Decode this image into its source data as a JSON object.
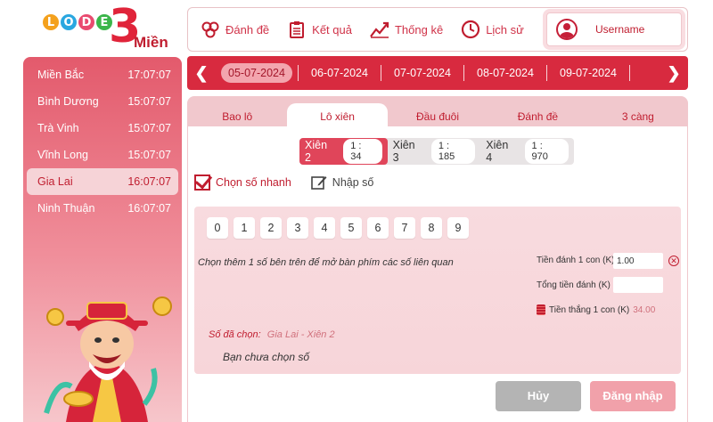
{
  "logo": {
    "letters": [
      "L",
      "O",
      "D",
      "E"
    ],
    "ball_colors": [
      "#f4a11d",
      "#2aa7e0",
      "#e94a6f",
      "#3bb54a"
    ],
    "big_number": "3",
    "word": "Miền"
  },
  "nav": {
    "items": [
      {
        "label": "Đánh đề",
        "icon": "dice-icon"
      },
      {
        "label": "Kết quả",
        "icon": "clipboard-icon"
      },
      {
        "label": "Thống kê",
        "icon": "chart-icon"
      },
      {
        "label": "Lịch sử",
        "icon": "clock-icon"
      }
    ],
    "username": "Username"
  },
  "sidebar": {
    "items": [
      {
        "name": "Miền Bắc",
        "time": "17:07:07"
      },
      {
        "name": "Bình Dương",
        "time": "15:07:07"
      },
      {
        "name": "Trà Vinh",
        "time": "15:07:07"
      },
      {
        "name": "Vĩnh Long",
        "time": "15:07:07"
      },
      {
        "name": "Gia Lai",
        "time": "16:07:07"
      },
      {
        "name": "Ninh Thuận",
        "time": "16:07:07"
      }
    ],
    "active_index": 4
  },
  "dates": {
    "items": [
      "05-07-2024",
      "06-07-2024",
      "07-07-2024",
      "08-07-2024",
      "09-07-2024"
    ],
    "active_index": 0
  },
  "tabs": {
    "items": [
      "Bao lô",
      "Lô xiên",
      "Đầu đuôi",
      "Đánh đề",
      "3 càng"
    ],
    "active_index": 1
  },
  "xien": {
    "items": [
      {
        "label": "Xiên 2",
        "odds": "1 : 34"
      },
      {
        "label": "Xiên 3",
        "odds": "1 : 185"
      },
      {
        "label": "Xiên 4",
        "odds": "1 : 970"
      }
    ],
    "active_index": 0
  },
  "modes": {
    "quick": "Chọn số nhanh",
    "manual": "Nhập số"
  },
  "numbers": [
    "0",
    "1",
    "2",
    "3",
    "4",
    "5",
    "6",
    "7",
    "8",
    "9"
  ],
  "hint": "Chọn thêm 1 số bên trên để mở bàn phím các số liên quan",
  "form": {
    "bet_label": "Tiền đánh 1 con (K)",
    "bet_value": "1.00",
    "total_label": "Tổng tiền đánh (K)",
    "total_value": "",
    "win_label": "Tiền thắng 1 con (K)",
    "win_value": "34.00"
  },
  "chosen": {
    "label": "Số đã chọn:",
    "value": "Gia Lai - Xiên 2",
    "empty": "Bạn chưa chọn số"
  },
  "buttons": {
    "cancel": "Hủy",
    "login": "Đăng nhập"
  },
  "colors": {
    "primary": "#d82a3f",
    "accent": "#c01d2f"
  }
}
